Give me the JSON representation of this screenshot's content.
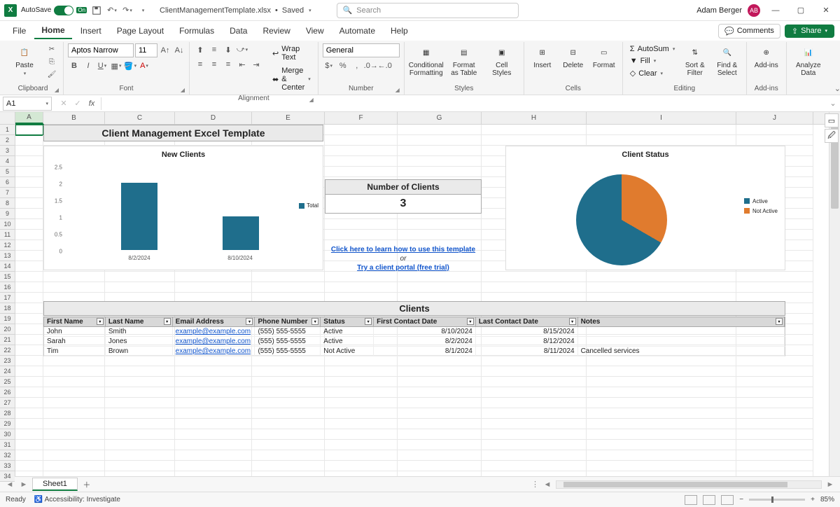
{
  "titlebar": {
    "autosave": "AutoSave",
    "autosave_on": "On",
    "filename": "ClientManagementTemplate.xlsx",
    "saved": "Saved",
    "search_placeholder": "Search",
    "user": "Adam Berger",
    "user_initials": "AB"
  },
  "tabs": [
    "File",
    "Home",
    "Insert",
    "Page Layout",
    "Formulas",
    "Data",
    "Review",
    "View",
    "Automate",
    "Help"
  ],
  "tabs_active": "Home",
  "comments_btn": "Comments",
  "share_btn": "Share",
  "ribbon": {
    "clipboard": {
      "paste": "Paste",
      "label": "Clipboard"
    },
    "font": {
      "name": "Aptos Narrow",
      "size": "11",
      "label": "Font"
    },
    "alignment": {
      "wrap": "Wrap Text",
      "merge": "Merge & Center",
      "label": "Alignment"
    },
    "number": {
      "format": "General",
      "label": "Number"
    },
    "styles": {
      "cond": "Conditional Formatting",
      "fat": "Format as Table",
      "cell": "Cell Styles",
      "label": "Styles"
    },
    "cells": {
      "insert": "Insert",
      "delete": "Delete",
      "format": "Format",
      "label": "Cells"
    },
    "editing": {
      "sum": "AutoSum",
      "fill": "Fill",
      "clear": "Clear",
      "sort": "Sort & Filter",
      "find": "Find & Select",
      "label": "Editing"
    },
    "addins": {
      "addins": "Add-ins",
      "label": "Add-ins"
    },
    "analysis": {
      "analyze": "Analyze Data"
    }
  },
  "name_box": "A1",
  "columns": [
    "A",
    "B",
    "C",
    "D",
    "E",
    "F",
    "G",
    "H",
    "I",
    "J"
  ],
  "row_count": 38,
  "sheet": {
    "title": "Client Management Excel Template",
    "num_clients_label": "Number of Clients",
    "num_clients": "3",
    "link1": "Click here to learn how to use this template",
    "or": "or",
    "link2": "Try a client portal (free trial)",
    "clients_label": "Clients",
    "headers": [
      "First Name",
      "Last Name",
      "Email Address",
      "Phone Number",
      "Status",
      "First Contact Date",
      "Last Contact Date",
      "Notes"
    ],
    "rows": [
      {
        "fn": "John",
        "ln": "Smith",
        "em": "example@example.com",
        "ph": "(555) 555-5555",
        "st": "Active",
        "fc": "8/10/2024",
        "lc": "8/15/2024",
        "nt": ""
      },
      {
        "fn": "Sarah",
        "ln": "Jones",
        "em": "example@example.com",
        "ph": "(555) 555-5555",
        "st": "Active",
        "fc": "8/2/2024",
        "lc": "8/12/2024",
        "nt": ""
      },
      {
        "fn": "Tim",
        "ln": "Brown",
        "em": "example@example.com",
        "ph": "(555) 555-5555",
        "st": "Not Active",
        "fc": "8/1/2024",
        "lc": "8/11/2024",
        "nt": "Cancelled services"
      }
    ]
  },
  "chart_data": [
    {
      "type": "bar",
      "title": "New Clients",
      "categories": [
        "8/2/2024",
        "8/10/2024"
      ],
      "values": [
        2,
        1
      ],
      "legend": [
        "Total"
      ],
      "ylim": [
        0,
        2.5
      ],
      "yticks": [
        0,
        0.5,
        1,
        1.5,
        2,
        2.5
      ]
    },
    {
      "type": "pie",
      "title": "Client Status",
      "series": [
        {
          "name": "Active",
          "value": 2,
          "color": "#1f6e8c"
        },
        {
          "name": "Not Active",
          "value": 1,
          "color": "#e07b2e"
        }
      ]
    }
  ],
  "sheet_tabs": {
    "active": "Sheet1"
  },
  "status": {
    "ready": "Ready",
    "access": "Accessibility: Investigate",
    "zoom": "85%"
  }
}
